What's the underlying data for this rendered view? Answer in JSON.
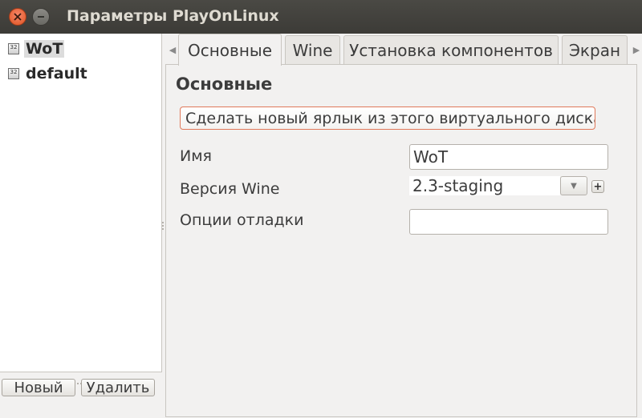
{
  "window": {
    "title": "Параметры PlayOnLinux"
  },
  "tree": {
    "items": [
      {
        "label": "WoT",
        "icon_text": "32",
        "selected": true
      },
      {
        "label": "default",
        "icon_text": "32",
        "selected": false
      }
    ]
  },
  "left_buttons": {
    "new_label": "Новый",
    "delete_label": "Удалить"
  },
  "tabs": [
    {
      "label": "Основные",
      "active": true
    },
    {
      "label": "Wine",
      "active": false
    },
    {
      "label": "Установка компонентов",
      "active": false
    },
    {
      "label": "Экран",
      "active": false
    }
  ],
  "general": {
    "heading": "Основные",
    "shortcut_button": "Сделать новый ярлык из этого виртуального диска",
    "name_label": "Имя",
    "name_value": "WoT",
    "wine_version_label": "Версия Wine",
    "wine_version_value": "2.3-staging",
    "debug_label": "Опции отладки",
    "debug_value": "",
    "add_version_symbol": "+"
  },
  "icons": {
    "close": "close-icon",
    "minimize": "minimize-icon",
    "tab_scroll_left": "chevron-left-icon",
    "tab_scroll_right": "chevron-right-icon",
    "dropdown": "chevron-down-icon",
    "prefix": "wine-prefix-icon"
  },
  "colors": {
    "titlebar": "#3c3b37",
    "close_button": "#e0531f",
    "focus_border": "#e0795a"
  }
}
